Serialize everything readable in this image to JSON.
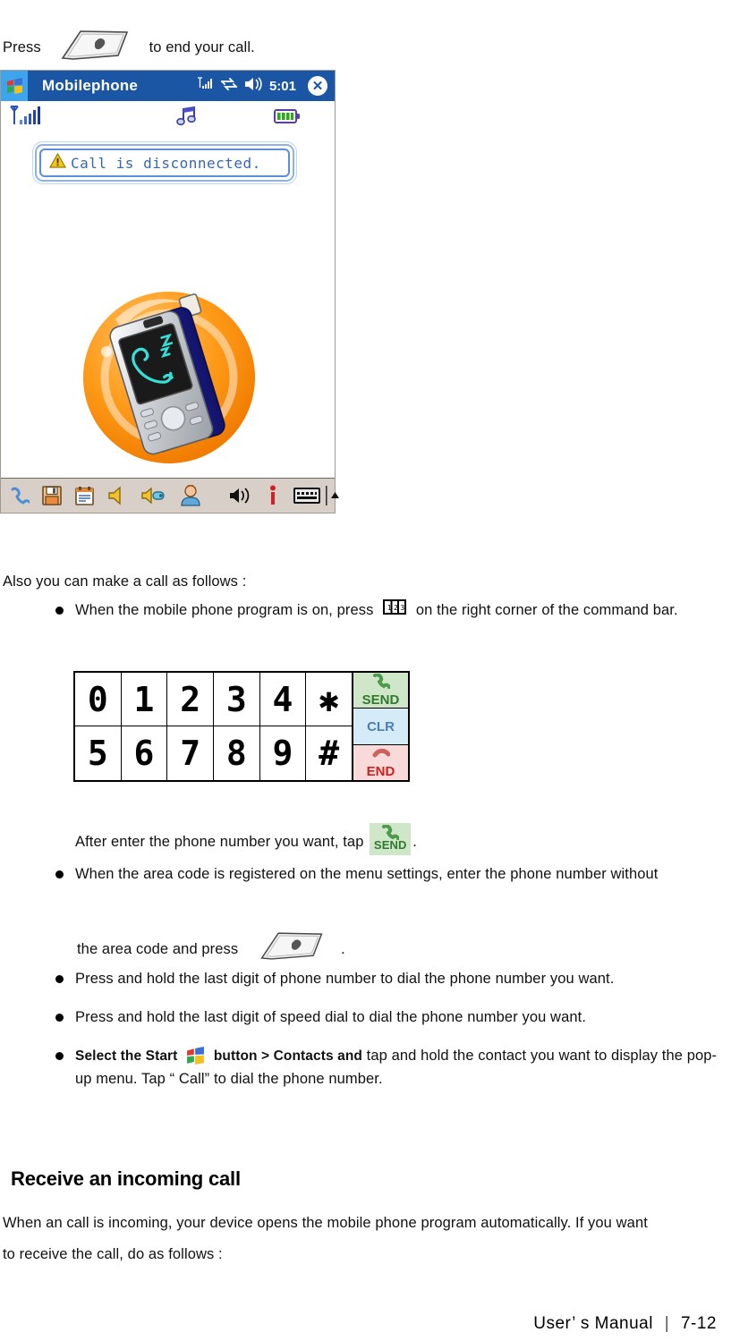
{
  "intro": {
    "before": "Press",
    "after": "to end your call.",
    "key_icon": "end-call-hardware-key-icon"
  },
  "pda": {
    "titlebar": {
      "start_icon": "windows-start-icon",
      "title": "Mobilephone",
      "signal_icon": "signal-bars-icon",
      "connection_icon": "connectivity-icon",
      "volume_icon": "volume-icon",
      "clock": "5:01",
      "close_icon": "close-icon"
    },
    "statusbar": {
      "signal_icon": "antenna-signal-icon",
      "music_icon": "music-note-icon",
      "battery_icon": "battery-full-icon"
    },
    "message": {
      "warning_icon": "warning-triangle-icon",
      "text": "Call is disconnected."
    },
    "illustration": "sleeping-mobile-phone-illustration",
    "toolbar_icons": [
      "phone-handset-icon",
      "save-disk-icon",
      "notes-icon",
      "speaker-mute-icon",
      "speaker-earpiece-icon",
      "contact-person-icon",
      "speaker-loud-icon",
      "info-icon",
      "keyboard-icon",
      "input-panel-chevron-icon"
    ]
  },
  "body": {
    "also_line": "Also you can make a call as follows :",
    "bullet1_part1": "When the mobile phone program is on, press",
    "bullet1_icon": "numeric-keypad-icon",
    "bullet1_part2": "on the right corner of the command bar.",
    "after_keypad_part1": "After enter the phone number you want, tap",
    "after_keypad_chip": "SEND",
    "after_keypad_part2": ".",
    "bullet2": "When the area code is registered on the menu settings, enter the phone number without",
    "bullet2_cont_before": "the area code and press",
    "bullet2_cont_after": ".",
    "bullet3": "Press and hold the last digit of phone number to dial the phone number you want.",
    "bullet4": "Press and hold the last digit of speed dial to dial the phone number you want.",
    "bullet5_bold1": "Select the Start",
    "bullet5_icon": "windows-start-icon",
    "bullet5_bold2": "button > Contacts and",
    "bullet5_rest": "tap and hold the contact you want to display the pop-up menu. Tap “ Call”  to dial the phone number."
  },
  "keypad": {
    "row1": [
      "0",
      "1",
      "2",
      "3",
      "4",
      "✱"
    ],
    "row2": [
      "5",
      "6",
      "7",
      "8",
      "9",
      "#"
    ],
    "side": [
      {
        "name": "send-key",
        "label": "SEND",
        "icon": "green-handset-icon",
        "color": "#cfe7c8"
      },
      {
        "name": "clear-key",
        "label": "CLR",
        "icon": "",
        "color": "#d5ecf8"
      },
      {
        "name": "end-key",
        "label": "END",
        "icon": "red-handset-icon",
        "color": "#f8dada"
      }
    ]
  },
  "section": {
    "heading": "Receive an incoming call",
    "para_line1": "When an call is incoming, your device opens the mobile phone program automatically. If you want",
    "para_line2": "to receive the call, do as follows :"
  },
  "footer": {
    "manual": "User’ s Manual",
    "separator": "|",
    "page": "7-12"
  }
}
